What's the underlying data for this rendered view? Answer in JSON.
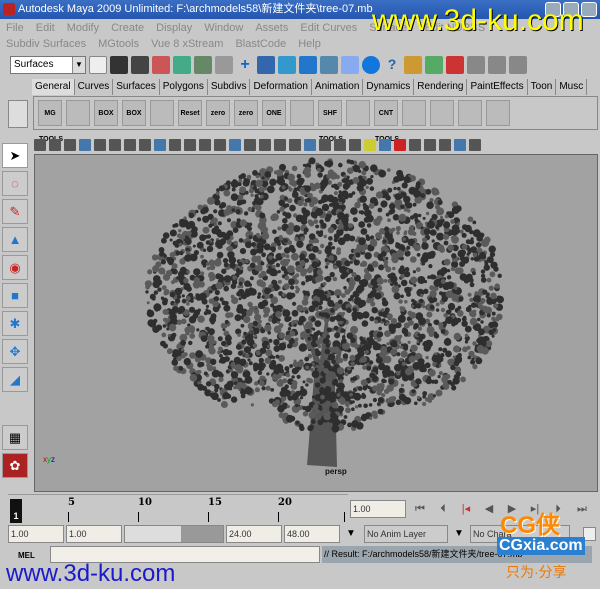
{
  "window": {
    "title": "Autodesk Maya 2009 Unlimited: F:\\archmodels58\\新建文件夹\\tree-07.mb"
  },
  "menu_row1": [
    "File",
    "Edit",
    "Modify",
    "Create",
    "Display",
    "Window",
    "Assets",
    "Edit Curves",
    "Surfaces",
    "Edit NURBS"
  ],
  "menu_row2": [
    "Subdiv Surfaces",
    "MGtools",
    "Vue 8 xStream",
    "BlastCode",
    "Help"
  ],
  "toolbar": {
    "menu_set": "Surfaces"
  },
  "shelf_tabs": [
    "General",
    "Curves",
    "Surfaces",
    "Polygons",
    "Subdivs",
    "Deformation",
    "Animation",
    "Dynamics",
    "Rendering",
    "PaintEffects",
    "Toon",
    "Musc"
  ],
  "active_tab": "General",
  "shelf_buttons": [
    "MG TOOLS",
    "",
    "BOX",
    "BOX",
    "",
    "Reset",
    "zero",
    "zero",
    "ONE",
    "",
    "SHF TOOLS",
    "",
    "CNT TOOLS",
    "",
    "",
    "",
    ""
  ],
  "viewport": {
    "camera": "persp",
    "background": "#a2a2a2"
  },
  "timeline": {
    "ticks": [
      "5",
      "10",
      "15",
      "20"
    ],
    "current_frame": "1",
    "current_time": "1.00"
  },
  "range": {
    "start": "1.00",
    "playback_start": "1.00",
    "playback_end": "24.00",
    "end": "48.00",
    "anim_layer": "No Anim Layer",
    "character": "No Chara"
  },
  "command": {
    "label": "MEL",
    "result": "// Result: F:/archmodels58/新建文件夹/tree-07.mb"
  },
  "watermarks": {
    "top": "www.3d-ku.com",
    "bottom": "www.3d-ku.com",
    "cg": "CG侠",
    "cgxia": "CGxia.com",
    "slogan": "只为·分享"
  }
}
